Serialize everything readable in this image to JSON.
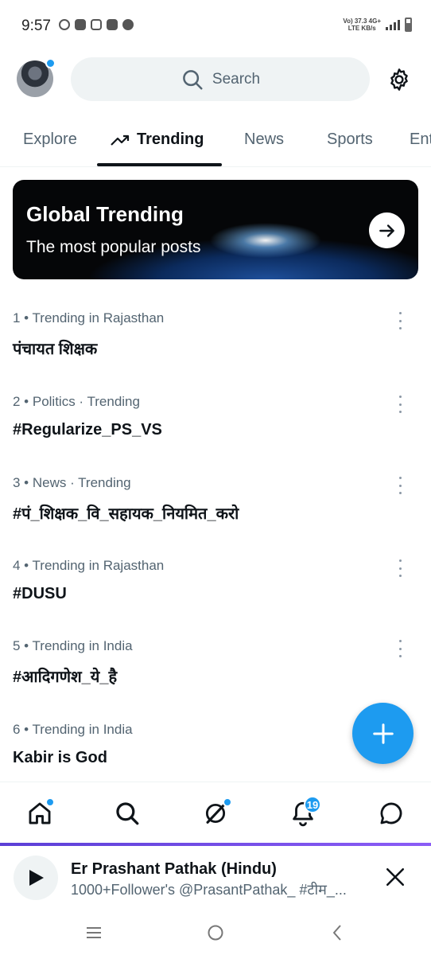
{
  "status_bar": {
    "time": "9:57",
    "network_top": "Vo) 37.3 4G+",
    "network_bottom": "LTE KB/s"
  },
  "header": {
    "search_placeholder": "Search",
    "avatar_has_notification": true
  },
  "tabs": [
    {
      "label": "Explore",
      "active": false
    },
    {
      "label": "Trending",
      "active": true
    },
    {
      "label": "News",
      "active": false
    },
    {
      "label": "Sports",
      "active": false
    },
    {
      "label": "Ent",
      "active": false
    }
  ],
  "banner": {
    "title": "Global Trending",
    "subtitle": "The most popular posts"
  },
  "trends": [
    {
      "meta": "1 • Trending in Rajasthan",
      "title": "पंचायत शिक्षक"
    },
    {
      "meta": "2 • Politics · Trending",
      "title": "#Regularize_PS_VS"
    },
    {
      "meta": "3 • News · Trending",
      "title": "#पं_शिक्षक_वि_सहायक_नियमित_करो"
    },
    {
      "meta": "4 • Trending in Rajasthan",
      "title": "#DUSU"
    },
    {
      "meta": "5 • Trending in India",
      "title": "#आदिगणेश_ये_है"
    },
    {
      "meta": "6 • Trending in India",
      "title": "Kabir is God"
    }
  ],
  "bottom_nav": {
    "notification_count": "19"
  },
  "player": {
    "title": "Er Prashant Pathak (Hindu)",
    "subtitle": "1000+Follower's @PrasantPathak_ #टीम_..."
  },
  "colors": {
    "accent": "#1d9bf0",
    "text_primary": "#0f1419",
    "text_secondary": "#536471",
    "player_line": "#6b4ce6"
  }
}
